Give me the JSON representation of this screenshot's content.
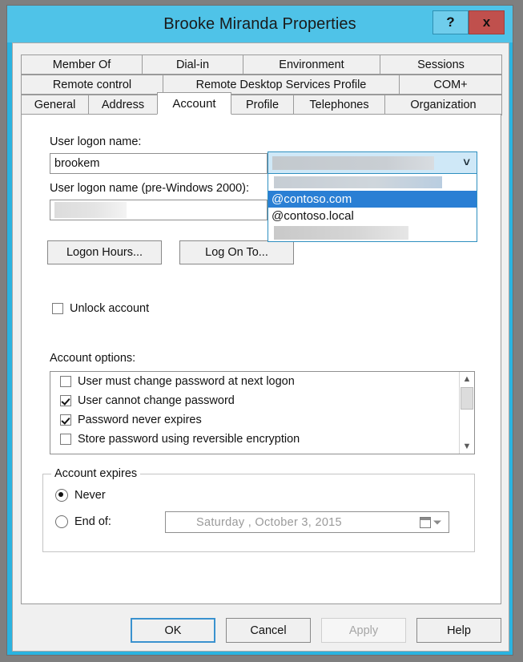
{
  "window": {
    "title": "Brooke Miranda Properties",
    "help_button": "?",
    "close_button": "x"
  },
  "tabs": {
    "row1": [
      {
        "label": "Member Of",
        "active": false
      },
      {
        "label": "Dial-in",
        "active": false
      },
      {
        "label": "Environment",
        "active": false
      },
      {
        "label": "Sessions",
        "active": false
      }
    ],
    "row2": [
      {
        "label": "Remote control",
        "active": false
      },
      {
        "label": "Remote Desktop Services Profile",
        "active": false
      },
      {
        "label": "COM+",
        "active": false
      }
    ],
    "row3": [
      {
        "label": "General",
        "active": false
      },
      {
        "label": "Address",
        "active": false
      },
      {
        "label": "Account",
        "active": true
      },
      {
        "label": "Profile",
        "active": false
      },
      {
        "label": "Telephones",
        "active": false
      },
      {
        "label": "Organization",
        "active": false
      }
    ]
  },
  "account": {
    "user_logon_name_label": "User logon name:",
    "user_logon_name_value": "brookem",
    "pre_windows_label": "User logon name (pre-Windows 2000):",
    "pre_windows_value": "",
    "upn_suffix_selected": "",
    "upn_suffix_options": [
      {
        "label": "",
        "redacted": true,
        "selected": false
      },
      {
        "label": "@contoso.com",
        "redacted": false,
        "selected": true
      },
      {
        "label": "@contoso.local",
        "redacted": false,
        "selected": false
      },
      {
        "label": "",
        "redacted": true,
        "selected": false
      }
    ],
    "logon_hours_button": "Logon Hours...",
    "log_on_to_button": "Log On To...",
    "unlock_account_label": "Unlock account",
    "unlock_account_checked": false,
    "account_options_label": "Account options:",
    "account_options": [
      {
        "label": "User must change password at next logon",
        "checked": false
      },
      {
        "label": "User cannot change password",
        "checked": true
      },
      {
        "label": "Password never expires",
        "checked": true
      },
      {
        "label": "Store password using reversible encryption",
        "checked": false
      }
    ],
    "account_expires": {
      "group_title": "Account expires",
      "never_label": "Never",
      "end_of_label": "End of:",
      "selected": "never",
      "date_value": "Saturday    ,   October     3, 2015"
    }
  },
  "footer": {
    "ok": "OK",
    "cancel": "Cancel",
    "apply": "Apply",
    "help": "Help",
    "apply_enabled": false
  },
  "colors": {
    "titlebar": "#4fc3e8",
    "close_button": "#c0504d",
    "selection": "#2a7fd4",
    "combo_border": "#2e8fc0",
    "default_button_border": "#3a92cf"
  }
}
